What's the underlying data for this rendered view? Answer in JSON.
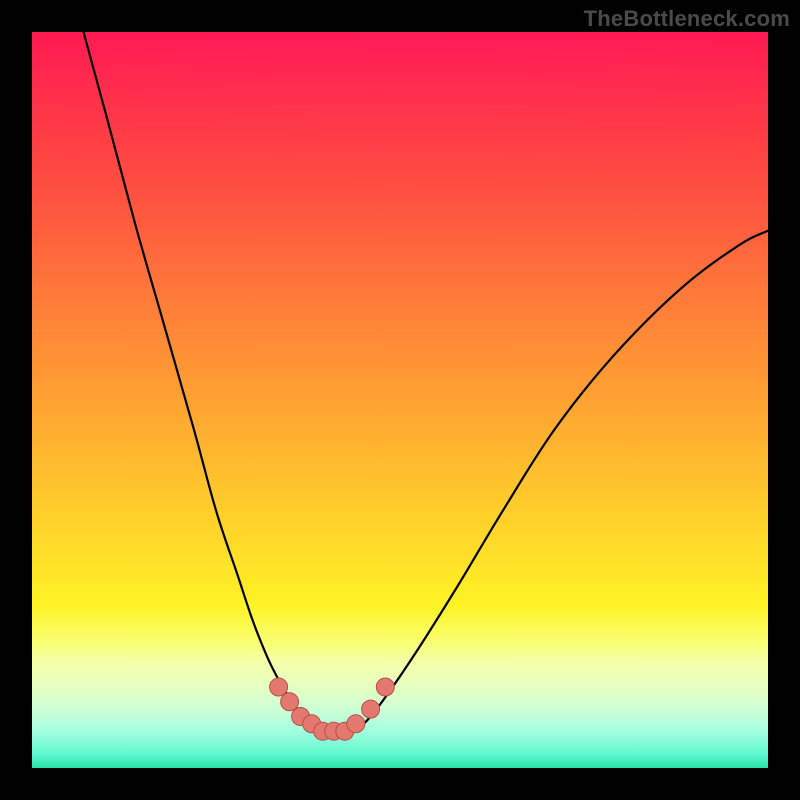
{
  "watermark": "TheBottleneck.com",
  "chart_data": {
    "type": "line",
    "title": "",
    "xlabel": "",
    "ylabel": "",
    "xlim": [
      0,
      100
    ],
    "ylim": [
      0,
      100
    ],
    "grid": false,
    "legend": false,
    "series": [
      {
        "name": "left-curve",
        "x": [
          7,
          10,
          14,
          18,
          22,
          25,
          28,
          30,
          32,
          33.5,
          35,
          36.5,
          38,
          39.5
        ],
        "y": [
          100,
          89,
          74,
          60,
          46,
          35,
          26,
          20,
          15,
          12,
          9.5,
          7.5,
          6,
          5
        ]
      },
      {
        "name": "right-curve",
        "x": [
          44,
          46,
          49,
          53,
          58,
          64,
          71,
          79,
          88,
          96,
          100
        ],
        "y": [
          5,
          7,
          11,
          17,
          25,
          35,
          46,
          56,
          65,
          71,
          73
        ]
      },
      {
        "name": "bottleneck-markers",
        "type": "scatter",
        "x": [
          33.5,
          35,
          36.5,
          38,
          39.5,
          41,
          42.5,
          44,
          46,
          48
        ],
        "y": [
          11,
          9,
          7,
          6,
          5,
          5,
          5,
          6,
          8,
          11
        ]
      }
    ],
    "colors": {
      "curve": "#000000",
      "marker_fill": "#e3796f",
      "marker_stroke": "#b45049"
    }
  }
}
